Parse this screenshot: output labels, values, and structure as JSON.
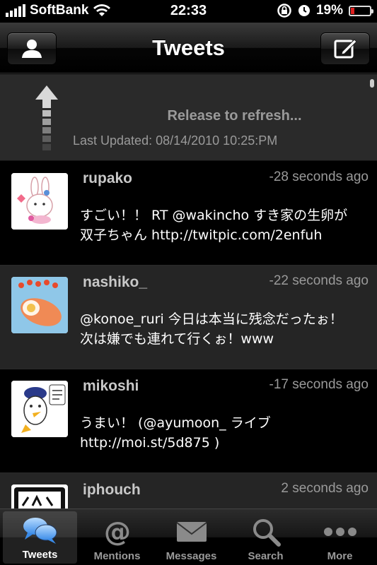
{
  "status_bar": {
    "carrier": "SoftBank",
    "time": "22:33",
    "battery_percent": "19%",
    "battery_level": 0.19,
    "icons": [
      "signal-icon",
      "wifi-icon",
      "rotation-lock-icon",
      "alarm-icon",
      "battery-icon"
    ]
  },
  "nav": {
    "title": "Tweets",
    "left_button_icon": "user-icon",
    "right_button_icon": "compose-icon"
  },
  "refresh": {
    "status": "Release to refresh...",
    "last_updated": "Last Updated: 08/14/2010 10:25:PM",
    "arrow_icon": "refresh-arrow-icon"
  },
  "tweets": [
    {
      "user": "rupako",
      "time": "-28 seconds ago",
      "text": "すごい！！ RT @wakincho すき家の生卵が\n双子ちゃん http://twitpic.com/2enfuh"
    },
    {
      "user": "nashiko_",
      "time": "-22 seconds ago",
      "text": "@konoe_ruri 今日は本当に残念だったぉ！\n次は嫌でも連れて行くぉ！www"
    },
    {
      "user": "mikoshi",
      "time": "-17 seconds ago",
      "text": "うまい！ (@ayumoon_ ライブ\nhttp://moi.st/5d875 )"
    },
    {
      "user": "iphouch",
      "time": "2 seconds ago",
      "text": ""
    }
  ],
  "tabs": [
    {
      "label": "Tweets",
      "icon": "tweets-icon",
      "active": true
    },
    {
      "label": "Mentions",
      "icon": "at-icon",
      "active": false
    },
    {
      "label": "Messages",
      "icon": "envelope-icon",
      "active": false
    },
    {
      "label": "Search",
      "icon": "search-icon",
      "active": false
    },
    {
      "label": "More",
      "icon": "more-icon",
      "active": false
    }
  ]
}
